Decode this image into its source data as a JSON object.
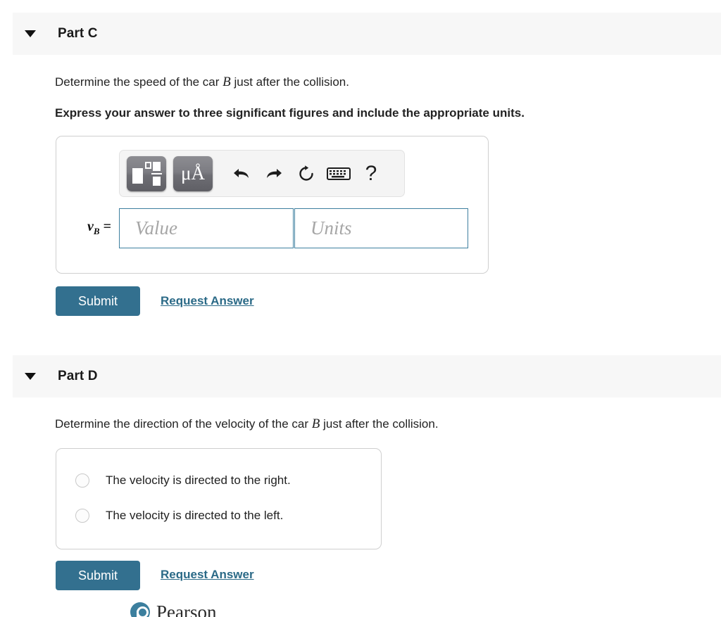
{
  "parts": {
    "c": {
      "title": "Part C",
      "prompt_before": "Determine the speed of the car",
      "prompt_var": "B",
      "prompt_after": "just after the collision.",
      "instruction": "Express your answer to three significant figures and include the appropriate units.",
      "answer": {
        "variable": "v",
        "subscript": "B",
        "equals": "=",
        "value_placeholder": "Value",
        "value_text": "",
        "units_placeholder": "Units",
        "units_text": ""
      },
      "toolbar": {
        "template_label": "template",
        "units_label": "μÅ",
        "undo_label": "undo",
        "redo_label": "redo",
        "reset_label": "reset",
        "keyboard_label": "keyboard",
        "help_label": "?"
      },
      "submit_label": "Submit",
      "request_label": "Request Answer"
    },
    "d": {
      "title": "Part D",
      "prompt_before": "Determine the direction of the velocity of the car",
      "prompt_var": "B",
      "prompt_after": "just after the collision.",
      "choices": [
        {
          "label": "The velocity is directed to the right.",
          "selected": false
        },
        {
          "label": "The velocity is directed to the left.",
          "selected": false
        }
      ],
      "submit_label": "Submit",
      "request_label": "Request Answer"
    }
  },
  "footer": {
    "brand": "Pearson"
  },
  "colors": {
    "accent": "#33708f",
    "link": "#2b6a87",
    "header_band": "#f7f7f7",
    "input_border": "#3d7f9f",
    "brand_mark": "#3c7f9e"
  }
}
